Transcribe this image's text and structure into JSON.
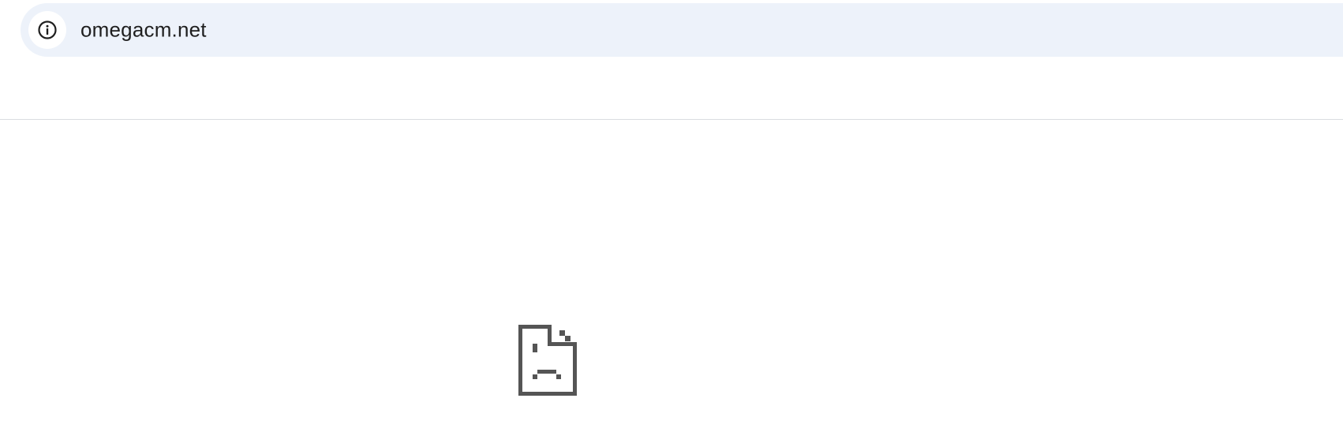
{
  "omnibox": {
    "url": "omegacm.net",
    "site_info_icon": "info-circle-icon"
  },
  "error_page": {
    "icon": "sad-page-icon",
    "icon_color": "#555555"
  },
  "colors": {
    "omnibox_background": "#edf2fa",
    "divider": "#dadce0",
    "text": "#1f1f1f"
  }
}
